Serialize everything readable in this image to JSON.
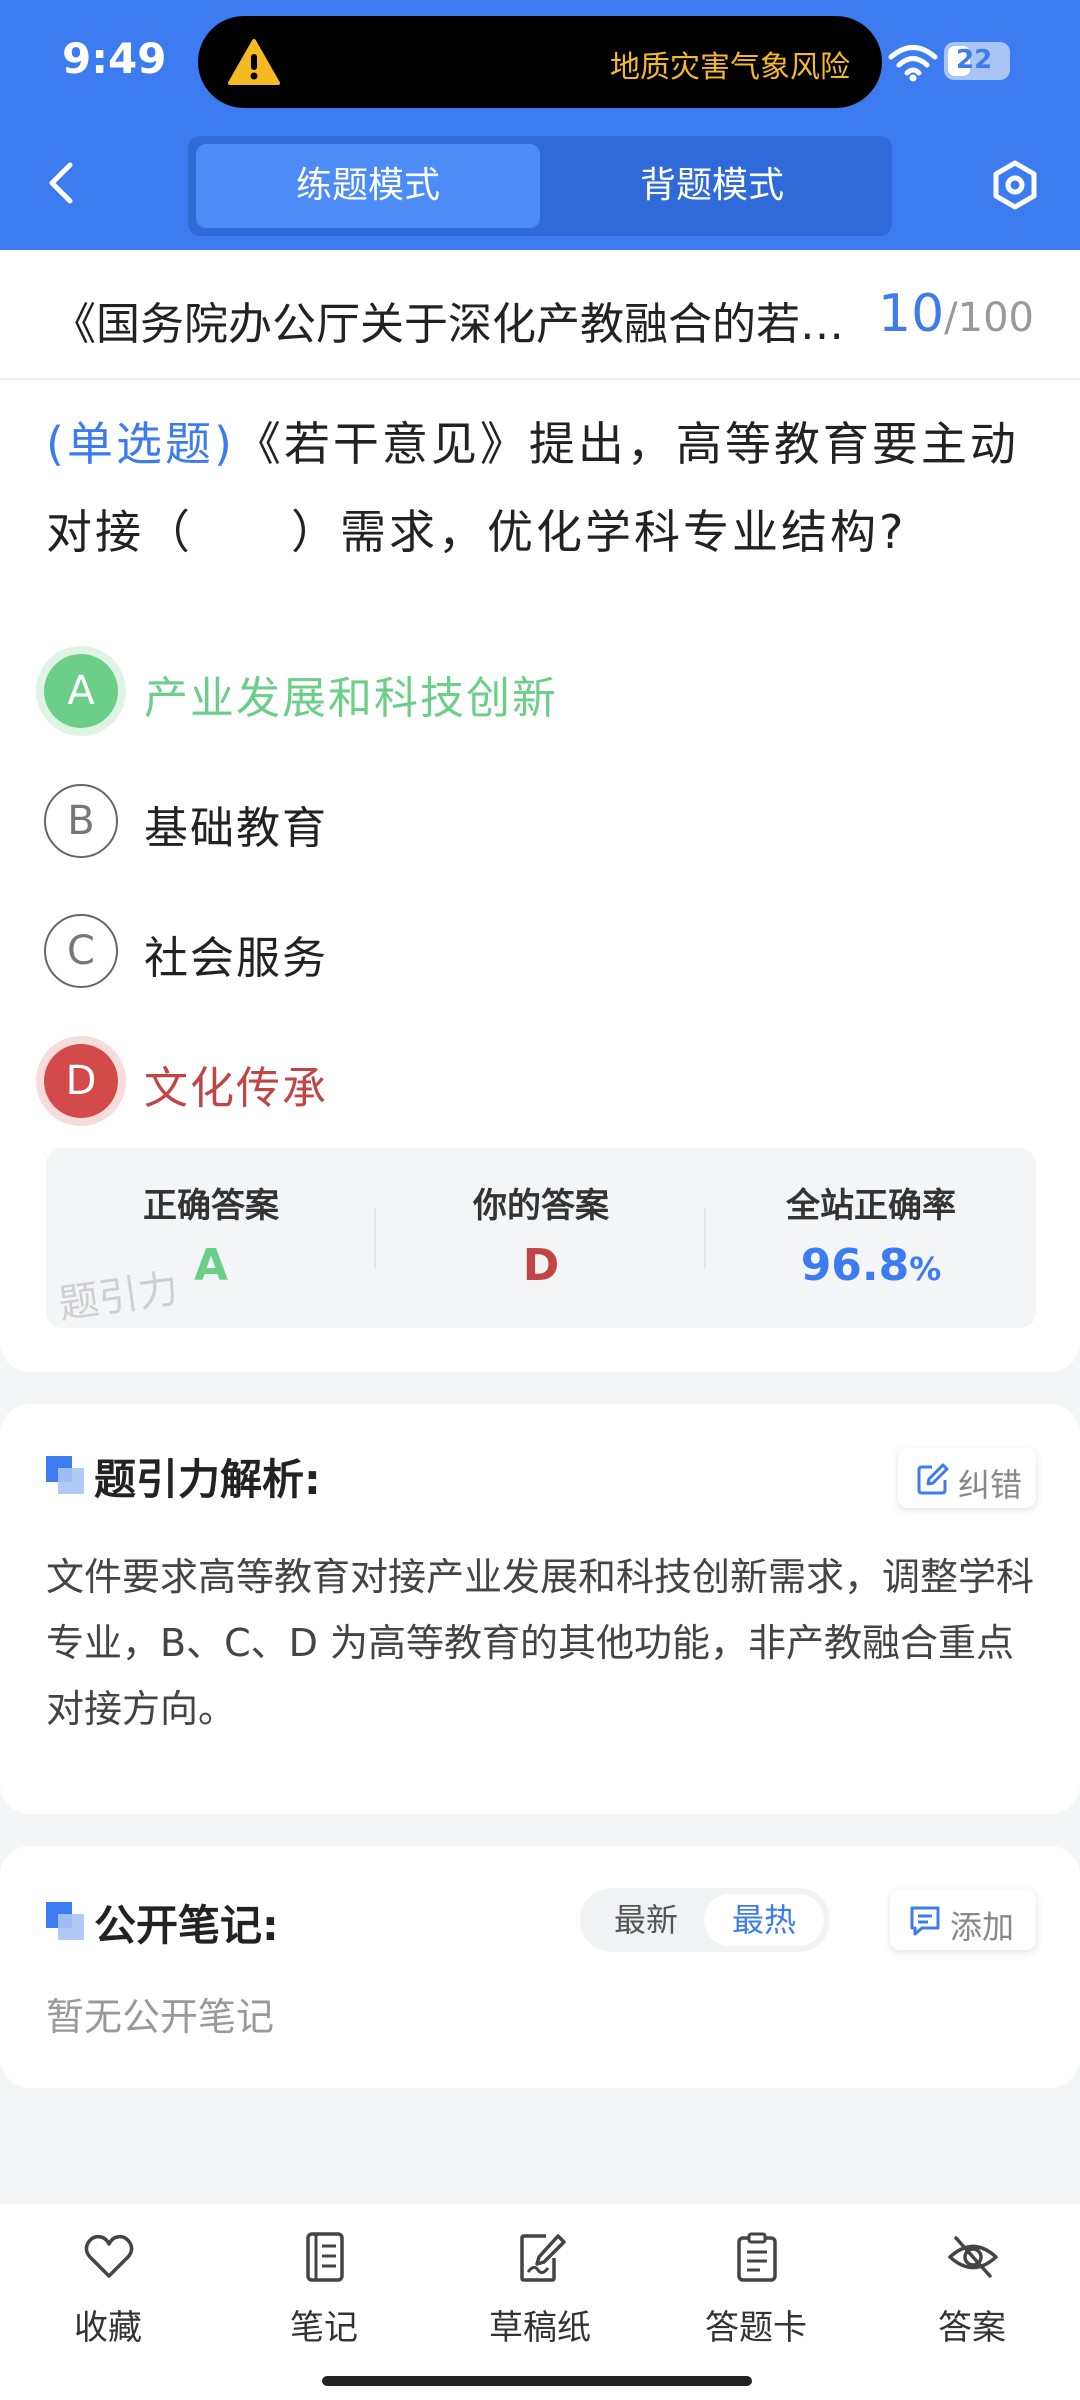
{
  "status": {
    "time": "9:49",
    "alert": "地质灾害气象风险",
    "battery": "22"
  },
  "header": {
    "mode_practice": "练题模式",
    "mode_review": "背题模式"
  },
  "question": {
    "doc_title": "《国务院办公厅关于深化产教融合的若干意见》",
    "current": "10",
    "slash": "/",
    "total": "100",
    "type": "(单选题)",
    "text": "《若干意见》提出，高等教育要主动对接（　　）需求，优化学科专业结构?"
  },
  "options": [
    {
      "letter": "A",
      "text": "产业发展和科技创新",
      "state": "correct"
    },
    {
      "letter": "B",
      "text": "基础教育",
      "state": "normal"
    },
    {
      "letter": "C",
      "text": "社会服务",
      "state": "normal"
    },
    {
      "letter": "D",
      "text": "文化传承",
      "state": "wrong"
    }
  ],
  "answer_summary": {
    "correct_label": "正确答案",
    "correct_value": "A",
    "yours_label": "你的答案",
    "yours_value": "D",
    "rate_label": "全站正确率",
    "rate_value": "96.8",
    "rate_unit": "%",
    "watermark": "题引力"
  },
  "explanation": {
    "title": "题引力解析:",
    "report_button": "纠错",
    "text": "文件要求高等教育对接产业发展和科技创新需求，调整学科专业，B、C、D 为高等教育的其他功能，非产教融合重点对接方向。"
  },
  "notes": {
    "title": "公开笔记:",
    "sort_latest": "最新",
    "sort_hot": "最热",
    "add_button": "添加",
    "empty": "暂无公开笔记"
  },
  "bottom_nav": [
    {
      "label": "收藏",
      "icon": "heart-icon"
    },
    {
      "label": "笔记",
      "icon": "notebook-icon"
    },
    {
      "label": "草稿纸",
      "icon": "draft-icon"
    },
    {
      "label": "答题卡",
      "icon": "answer-card-icon"
    },
    {
      "label": "答案",
      "icon": "eye-off-icon"
    }
  ],
  "colors": {
    "primary": "#3d7cf0",
    "correct": "#6ccf89",
    "wrong": "#d24a4a",
    "alert": "#f5b921"
  }
}
